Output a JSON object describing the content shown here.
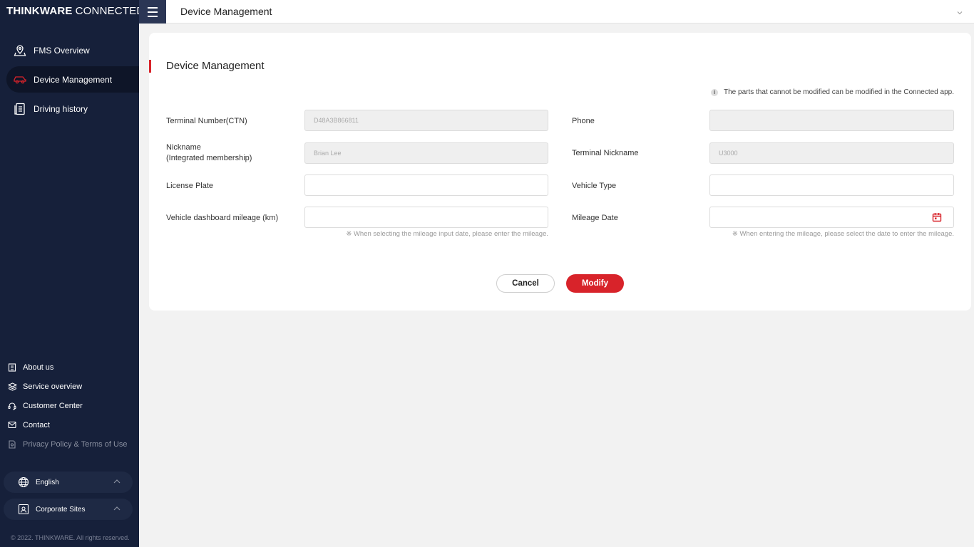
{
  "brand": {
    "bold": "THINKWARE",
    "thin": "CONNECTED"
  },
  "nav": {
    "items": [
      {
        "label": "FMS Overview"
      },
      {
        "label": "Device Management"
      },
      {
        "label": "Driving history"
      }
    ]
  },
  "links": {
    "items": [
      {
        "label": "About us"
      },
      {
        "label": "Service overview"
      },
      {
        "label": "Customer Center"
      },
      {
        "label": "Contact"
      },
      {
        "label": "Privacy Policy & Terms of Use"
      }
    ]
  },
  "language": {
    "label": "English"
  },
  "corporate": {
    "label": "Corporate Sites"
  },
  "copyright": "© 2022. THINKWARE. All rights reserved.",
  "header": {
    "title": "Device Management"
  },
  "page": {
    "title": "Device Management",
    "note": "The parts that cannot be modified can be modified in the Connected app."
  },
  "form": {
    "terminal_number": {
      "label": "Terminal Number(CTN)",
      "value": "D48A3B866811"
    },
    "phone": {
      "label": "Phone",
      "value": ""
    },
    "nickname": {
      "label_line1": "Nickname",
      "label_line2": "(Integrated membership)",
      "value": "Brian Lee"
    },
    "terminal_nickname": {
      "label": "Terminal Nickname",
      "value": "U3000"
    },
    "license_plate": {
      "label": "License Plate",
      "value": ""
    },
    "vehicle_type": {
      "label": "Vehicle Type",
      "value": ""
    },
    "mileage": {
      "label": "Vehicle dashboard mileage (km)",
      "value": "",
      "hint": "※ When selecting the mileage input date, please enter the mileage."
    },
    "mileage_date": {
      "label": "Mileage Date",
      "value": "",
      "hint": "※ When entering the mileage, please select the date to enter the mileage."
    }
  },
  "actions": {
    "cancel": "Cancel",
    "modify": "Modify"
  },
  "colors": {
    "accent": "#d8232a",
    "sidebar": "#16203a"
  }
}
